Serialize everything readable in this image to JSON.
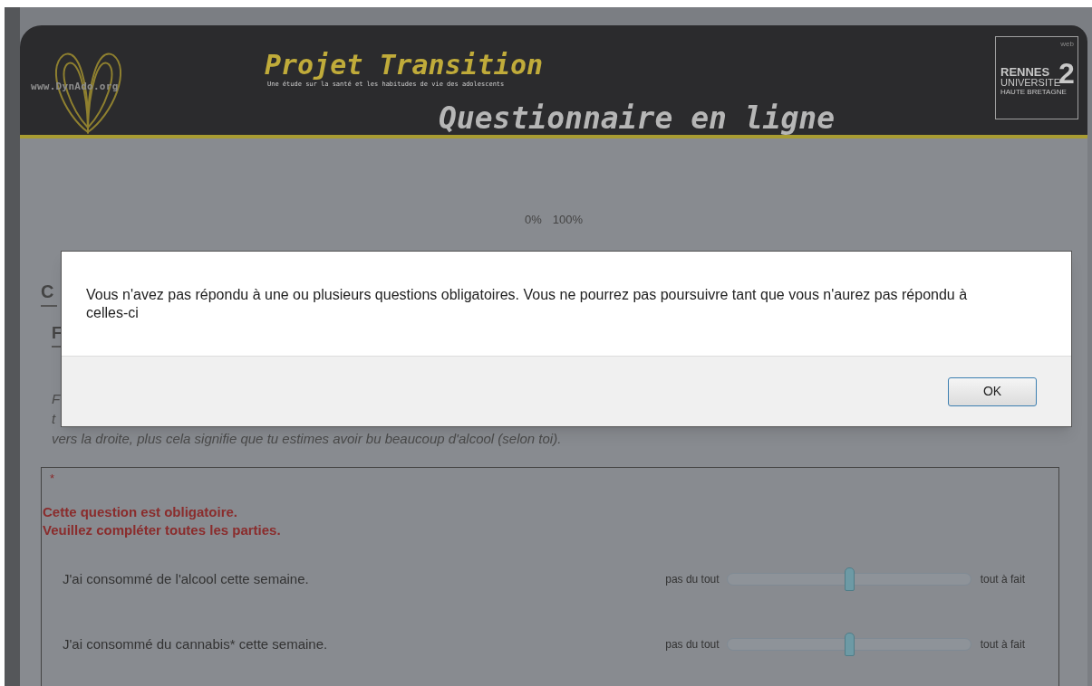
{
  "header": {
    "site_url": "www.DynAdo.org",
    "title": "Projet Transition",
    "subtitle": "Une étude sur la santé et les habitudes de vie des adolescents",
    "heading": "Questionnaire en ligne",
    "university_logo": {
      "corner": "web",
      "name": "RENNES",
      "number": "2",
      "line_2": "UNIVERSITE",
      "line_3": "HAUTE BRETAGNE"
    }
  },
  "progress": {
    "start_label": "0%",
    "end_label": "100%"
  },
  "section_heading": "C",
  "question_heading": "F",
  "instructions": [
    "F",
    "t",
    "vers la droite, plus cela signifie que tu estimes avoir bu beaucoup d'alcool (selon toi)."
  ],
  "question": {
    "required_mark": "*",
    "errors": [
      "Cette question est obligatoire.",
      "Veuillez compléter toutes les parties."
    ],
    "items": [
      {
        "label": "J'ai consommé de l'alcool cette semaine.",
        "min_label": "pas du tout",
        "max_label": "tout à fait",
        "level": 0.5
      },
      {
        "label": "J'ai consommé du cannabis* cette semaine.",
        "min_label": "pas du tout",
        "max_label": "tout à fait",
        "level": 0.5
      }
    ]
  },
  "dialog": {
    "message": "Vous n'avez pas répondu à une ou plusieurs questions obligatoires. Vous ne pourrez pas poursuivre tant que vous n'aurez pas répondu à celles-ci",
    "button": "OK"
  }
}
